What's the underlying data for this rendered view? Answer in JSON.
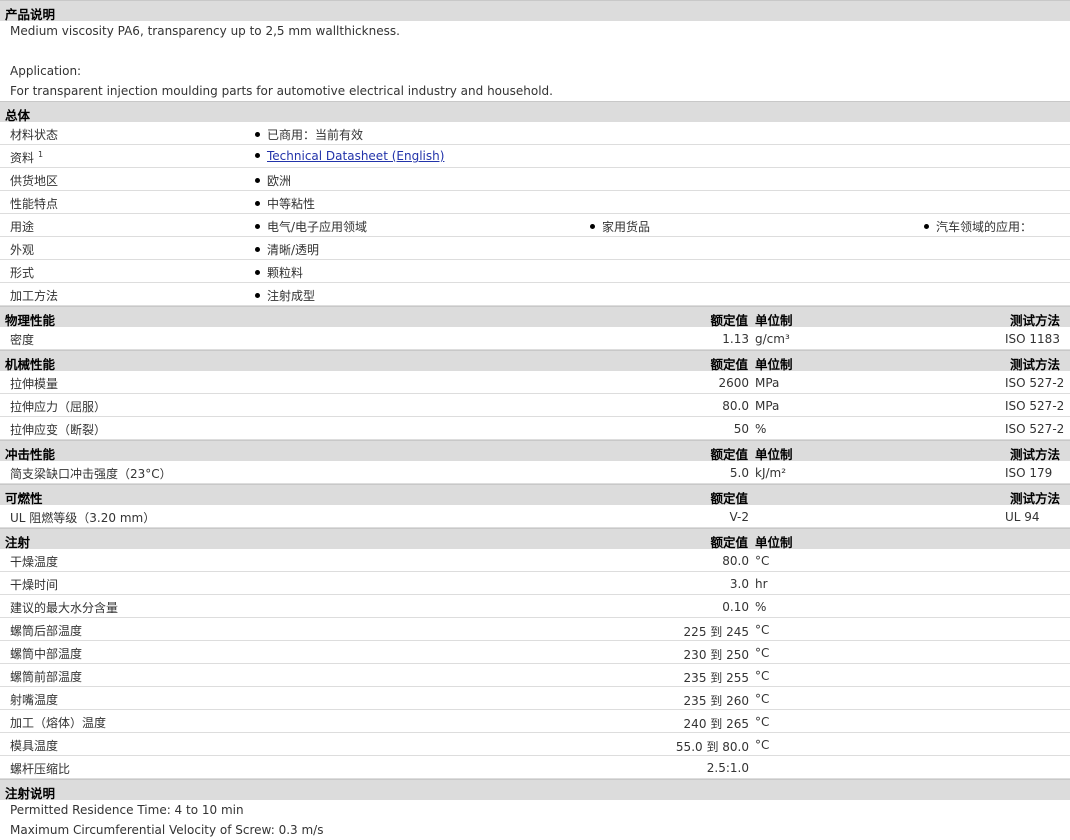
{
  "desc": {
    "title": "产品说明",
    "line1": "Medium viscosity PA6, transparency up to 2,5 mm wallthickness.",
    "line2": "Application:",
    "line3": "For transparent injection moulding parts for automotive electrical industry and household."
  },
  "general": {
    "title": "总体",
    "rows": [
      {
        "label": "材料状态",
        "items": [
          "已商用：当前有效"
        ]
      },
      {
        "label": "资料",
        "sup": "1",
        "link": "Technical Datasheet (English)"
      },
      {
        "label": "供货地区",
        "items": [
          "欧洲"
        ]
      },
      {
        "label": "性能特点",
        "items": [
          "中等粘性"
        ]
      },
      {
        "label": "用途",
        "items": [
          "电气/电子应用领域",
          "家用货品",
          "汽车领域的应用："
        ]
      },
      {
        "label": "外观",
        "items": [
          "清晰/透明"
        ]
      },
      {
        "label": "形式",
        "items": [
          "颗粒料"
        ]
      },
      {
        "label": "加工方法",
        "items": [
          "注射成型"
        ]
      }
    ]
  },
  "headers": {
    "value": "额定值",
    "unit": "单位制",
    "method": "测试方法"
  },
  "physical": {
    "title": "物理性能",
    "rows": [
      {
        "label": "密度",
        "value": "1.13",
        "unit": "g/cm³",
        "method": "ISO 1183"
      }
    ]
  },
  "mechanical": {
    "title": "机械性能",
    "rows": [
      {
        "label": "拉伸模量",
        "value": "2600",
        "unit": "MPa",
        "method": "ISO 527-2"
      },
      {
        "label": "拉伸应力（屈服）",
        "value": "80.0",
        "unit": "MPa",
        "method": "ISO 527-2"
      },
      {
        "label": "拉伸应变（断裂）",
        "value": "50",
        "unit": "%",
        "method": "ISO 527-2"
      }
    ]
  },
  "impact": {
    "title": "冲击性能",
    "rows": [
      {
        "label": "简支梁缺口冲击强度（23°C）",
        "value": "5.0",
        "unit": "kJ/m²",
        "method": "ISO 179"
      }
    ]
  },
  "flammability": {
    "title": "可燃性",
    "rows": [
      {
        "label": "UL 阻燃等级（3.20 mm）",
        "value": "V-2",
        "unit": "",
        "method": "UL 94"
      }
    ]
  },
  "injection": {
    "title": "注射",
    "rows": [
      {
        "label": "干燥温度",
        "value": "80.0",
        "unit": "°C"
      },
      {
        "label": "干燥时间",
        "value": "3.0",
        "unit": "hr"
      },
      {
        "label": "建议的最大水分含量",
        "value": "0.10",
        "unit": "%"
      },
      {
        "label": "螺筒后部温度",
        "value": "225 到  245",
        "unit": "°C"
      },
      {
        "label": "螺筒中部温度",
        "value": "230 到  250",
        "unit": "°C"
      },
      {
        "label": "螺筒前部温度",
        "value": "235 到  255",
        "unit": "°C"
      },
      {
        "label": "射嘴温度",
        "value": "235 到  260",
        "unit": "°C"
      },
      {
        "label": "加工（熔体）温度",
        "value": "240 到  265",
        "unit": "°C"
      },
      {
        "label": "模具温度",
        "value": "55.0 到  80.0",
        "unit": "°C"
      },
      {
        "label": "螺杆压缩比",
        "value": "2.5:1.0",
        "unit": ""
      }
    ]
  },
  "notes": {
    "title": "注射说明",
    "line1": "Permitted Residence Time: 4 to 10 min",
    "line2": "Maximum Circumferential Velocity of Screw: 0.3 m/s"
  }
}
